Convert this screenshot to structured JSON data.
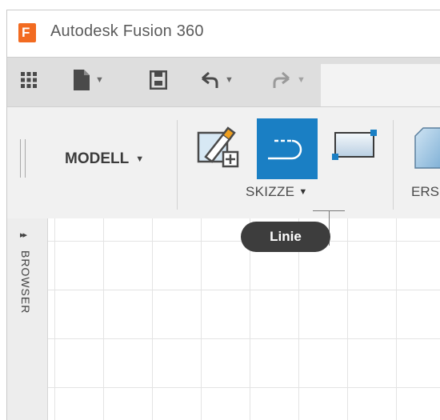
{
  "window": {
    "app_title": "Autodesk Fusion 360",
    "logo_letter": "F"
  },
  "quick_access": {
    "items": [
      "grid-menu-icon",
      "file-icon",
      "save-icon",
      "undo-icon",
      "redo-icon"
    ]
  },
  "ribbon": {
    "workspace_label": "MODELL",
    "groups": [
      {
        "label": "SKIZZE",
        "tools": [
          "create-sketch-icon",
          "line-icon",
          "rectangle-icon"
        ]
      },
      {
        "label": "ERS"
      }
    ]
  },
  "browser": {
    "label": "BROWSER",
    "expand": "▸▸"
  },
  "tooltip": {
    "text": "Linie"
  },
  "colors": {
    "accent": "#1a7fc4",
    "logo": "#f26b21",
    "tooltip_bg": "#3d3d3d"
  }
}
